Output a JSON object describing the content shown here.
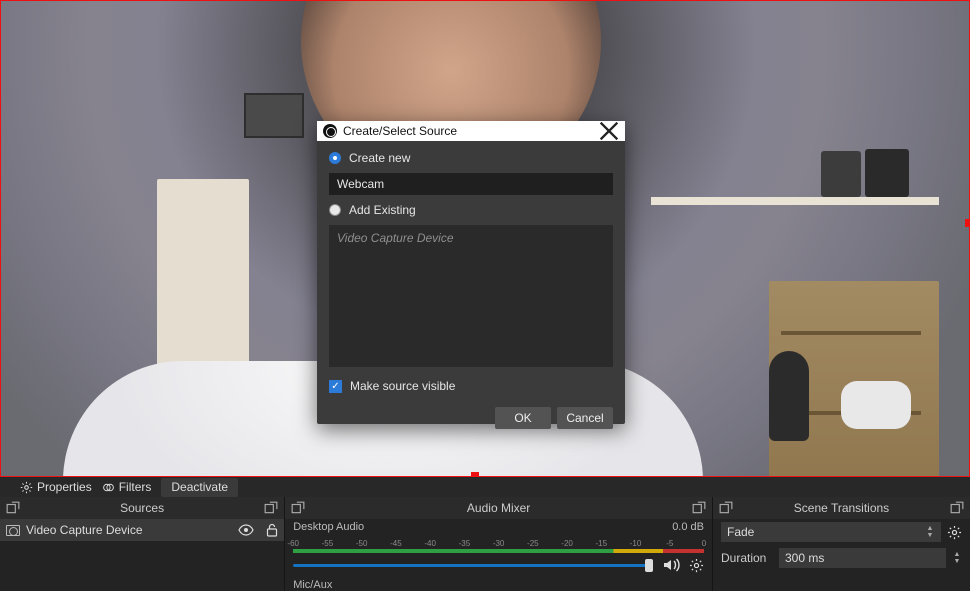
{
  "dialog": {
    "title": "Create/Select Source",
    "create_new_label": "Create new",
    "create_new_checked": true,
    "name_value": "Webcam",
    "add_existing_label": "Add Existing",
    "add_existing_checked": false,
    "existing_items": [
      "Video Capture Device"
    ],
    "make_visible_label": "Make source visible",
    "make_visible_checked": true,
    "ok_label": "OK",
    "cancel_label": "Cancel"
  },
  "src_toolbar": {
    "properties_label": "Properties",
    "filters_label": "Filters",
    "deactivate_label": "Deactivate"
  },
  "panels": {
    "sources": {
      "title": "Sources",
      "items": [
        {
          "name": "Video Capture Device",
          "visible": true,
          "locked": false
        }
      ]
    },
    "mixer": {
      "title": "Audio Mixer",
      "channels": [
        {
          "name": "Desktop Audio",
          "db": "0.0 dB"
        }
      ],
      "scale": [
        "-60",
        "-55",
        "-50",
        "-45",
        "-40",
        "-35",
        "-30",
        "-25",
        "-20",
        "-15",
        "-10",
        "-5",
        "0"
      ],
      "mic_label": "Mic/Aux"
    },
    "transitions": {
      "title": "Scene Transitions",
      "selected": "Fade",
      "duration_label": "Duration",
      "duration_value": "300 ms"
    }
  }
}
